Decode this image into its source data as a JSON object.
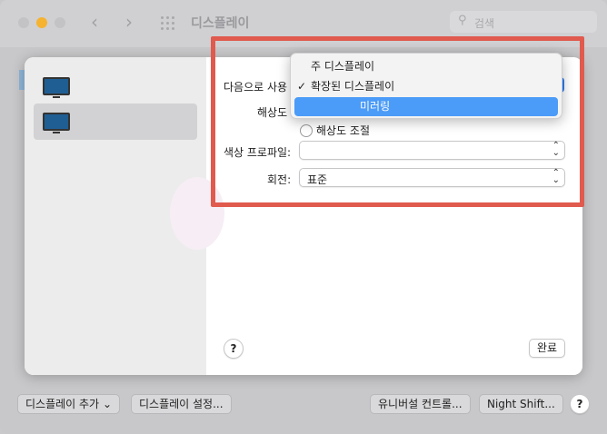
{
  "window": {
    "title": "디스플레이",
    "search_placeholder": "검색"
  },
  "sheet": {
    "displays": [
      "display-1",
      "display-2"
    ],
    "use_as_label": "다음으로 사용",
    "resolution_label": "해상도",
    "resolution_option": "해상도 조절",
    "color_profile_label": "색상 프로파일:",
    "color_profile_value": "",
    "rotation_label": "회전:",
    "rotation_value": "표준",
    "help": "?",
    "done": "완료"
  },
  "menu": {
    "items": [
      {
        "label": "주 디스플레이",
        "checked": false,
        "highlighted": false
      },
      {
        "label": "확장된 디스플레이",
        "checked": true,
        "highlighted": false
      },
      {
        "label": "미러링",
        "checked": false,
        "highlighted": true
      }
    ]
  },
  "bottom_bar": {
    "add_display": "디스플레이 추가",
    "display_settings": "디스플레이 설정...",
    "universal_control": "유니버설 컨트롤...",
    "night_shift": "Night Shift...",
    "help": "?"
  },
  "colors": {
    "accent": "#4b9bf8",
    "highlight_frame": "#e05a4e",
    "minimize": "#f5b330"
  }
}
